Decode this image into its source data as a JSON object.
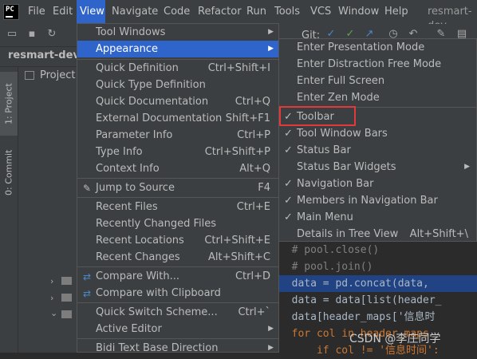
{
  "menubar": {
    "logo_text": "PC",
    "items": [
      "File",
      "Edit",
      "View",
      "Navigate",
      "Code",
      "Refactor",
      "Run",
      "Tools",
      "VCS",
      "Window",
      "Help"
    ],
    "project_title": "resmart-dev"
  },
  "navbar": {
    "project": "resmart-dev"
  },
  "toolbar": {
    "git_label": "Git:"
  },
  "left_tabs": {
    "project": "1: Project",
    "commit": "0: Commit"
  },
  "project_panel": {
    "label": "Project"
  },
  "view_menu": {
    "items": [
      {
        "label": "Tool Windows",
        "shortcut": "",
        "submenu": true
      },
      {
        "label": "Appearance",
        "shortcut": "",
        "submenu": true
      },
      {
        "label": "Quick Definition",
        "shortcut": "Ctrl+Shift+I"
      },
      {
        "label": "Quick Type Definition",
        "shortcut": ""
      },
      {
        "label": "Quick Documentation",
        "shortcut": "Ctrl+Q"
      },
      {
        "label": "External Documentation",
        "shortcut": "Shift+F1"
      },
      {
        "label": "Parameter Info",
        "shortcut": "Ctrl+P"
      },
      {
        "label": "Type Info",
        "shortcut": "Ctrl+Shift+P"
      },
      {
        "label": "Context Info",
        "shortcut": "Alt+Q"
      },
      {
        "label": "Jump to Source",
        "shortcut": "F4"
      },
      {
        "label": "Recent Files",
        "shortcut": "Ctrl+E"
      },
      {
        "label": "Recently Changed Files",
        "shortcut": ""
      },
      {
        "label": "Recent Locations",
        "shortcut": "Ctrl+Shift+E"
      },
      {
        "label": "Recent Changes",
        "shortcut": "Alt+Shift+C"
      },
      {
        "label": "Compare With...",
        "shortcut": "Ctrl+D"
      },
      {
        "label": "Compare with Clipboard",
        "shortcut": ""
      },
      {
        "label": "Quick Switch Scheme...",
        "shortcut": "Ctrl+`"
      },
      {
        "label": "Active Editor",
        "shortcut": "",
        "submenu": true
      },
      {
        "label": "Bidi Text Base Direction",
        "shortcut": "",
        "submenu": true
      }
    ]
  },
  "appearance_menu": {
    "items": [
      {
        "label": "Enter Presentation Mode",
        "checked": false,
        "shortcut": ""
      },
      {
        "label": "Enter Distraction Free Mode",
        "checked": false,
        "shortcut": ""
      },
      {
        "label": "Enter Full Screen",
        "checked": false,
        "shortcut": ""
      },
      {
        "label": "Enter Zen Mode",
        "checked": false,
        "shortcut": ""
      },
      {
        "label": "Toolbar",
        "checked": true,
        "shortcut": ""
      },
      {
        "label": "Tool Window Bars",
        "checked": true,
        "shortcut": ""
      },
      {
        "label": "Status Bar",
        "checked": true,
        "shortcut": ""
      },
      {
        "label": "Status Bar Widgets",
        "checked": false,
        "shortcut": "",
        "submenu": true
      },
      {
        "label": "Navigation Bar",
        "checked": true,
        "shortcut": ""
      },
      {
        "label": "Members in Navigation Bar",
        "checked": true,
        "shortcut": ""
      },
      {
        "label": "Main Menu",
        "checked": true,
        "shortcut": ""
      },
      {
        "label": "Details in Tree View",
        "checked": false,
        "shortcut": "Alt+Shift+\\"
      }
    ]
  },
  "editor": {
    "lines": [
      "  # pool.close()",
      "  # pool.join()",
      "  data = pd.concat(data,",
      "  data = data[list(header_",
      "  data[header_maps['信息时",
      "  for col in header_maps",
      "      if col != '信息时间':"
    ]
  },
  "watermark": "CSDN @李庄同学",
  "colors": {
    "accent": "#2f65ca",
    "highlight_box": "#e23a3a",
    "menu_bg": "#3c3f41"
  }
}
